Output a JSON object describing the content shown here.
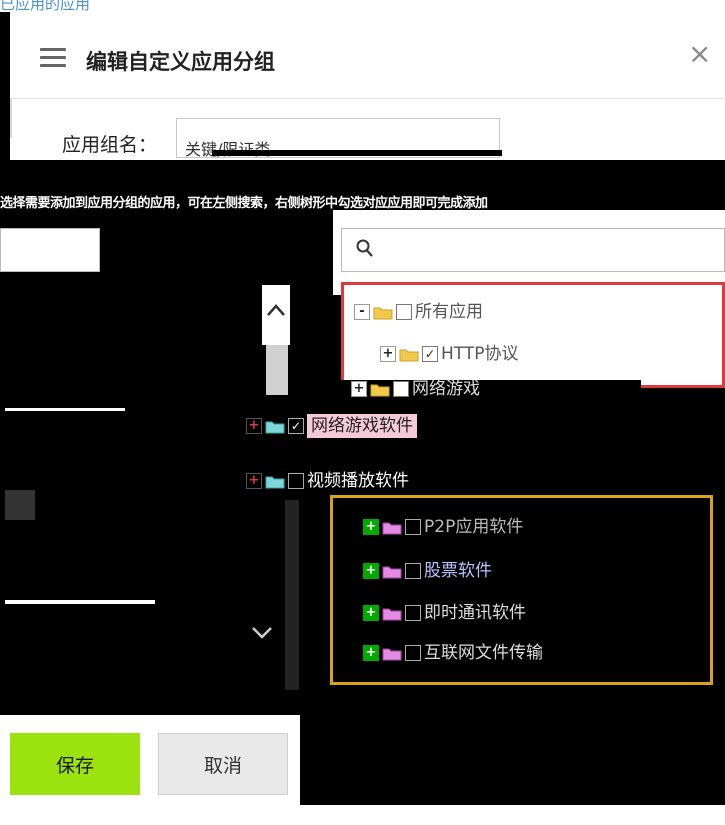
{
  "top_link": "已应用的应用",
  "dialog": {
    "title": "编辑自定义应用分组",
    "close_glyph": "×",
    "group_name_label": "应用组名：",
    "group_name_value": "关键/限证类"
  },
  "tips_text": "选择需要添加到应用分组的应用，可在左侧搜索，右侧树形中勾选对应应用即可完成添加",
  "tree_top": [
    {
      "toggle": "-",
      "label": "所有应用",
      "checked": false
    },
    {
      "toggle": "+",
      "label": "HTTP协议",
      "checked": true
    },
    {
      "toggle": "+",
      "label": "网络游戏",
      "checked": false
    }
  ],
  "tree_mid": [
    {
      "toggle": "+",
      "label": "网络游戏软件",
      "checked": true
    },
    {
      "toggle": "+",
      "label": "视频播放软件",
      "checked": false
    }
  ],
  "tree_children": [
    {
      "toggle": "+",
      "label": "P2P应用软件",
      "checked": false
    },
    {
      "toggle": "+",
      "label": "股票软件",
      "checked": false
    },
    {
      "toggle": "+",
      "label": "即时通讯软件",
      "checked": false
    },
    {
      "toggle": "+",
      "label": "互联网文件传输",
      "checked": false
    }
  ],
  "buttons": {
    "save": "保存",
    "cancel": "取消"
  },
  "colors": {
    "save_bg": "#9be20f",
    "tree_top_border": "#e0393e",
    "tree_bottom_border": "#d9a21b",
    "folder_yellow": "#f2c94c",
    "folder_teal": "#7fd6d6",
    "folder_pink": "#e38ae3"
  }
}
